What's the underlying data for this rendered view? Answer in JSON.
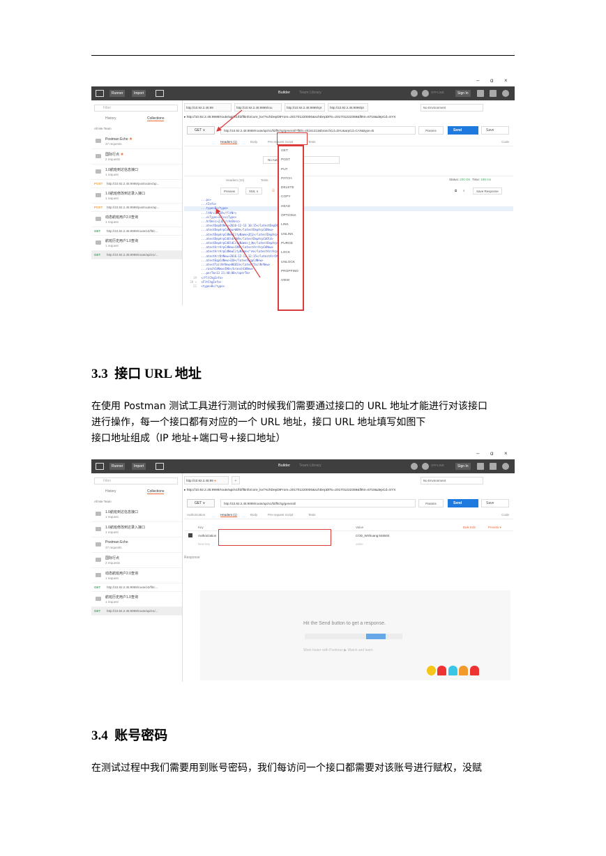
{
  "sections": {
    "s33": {
      "number": "3.3",
      "title": "接口 URL 地址"
    },
    "s34": {
      "number": "3.4",
      "title": "账号密码"
    }
  },
  "paragraphs": {
    "p1_line1": "在使用 Postman 测试工具进行测试的时候我们需要通过接口的 URL 地址才能进行对该接口",
    "p1_line2": "进行操作，每一个接口都有对应的一个 URL 地址，接口 URL 地址填写如图下",
    "p1_line3": "接口地址组成（IP 地址+端口号+接口地址）",
    "p2_line1": "在测试过程中我们需要用到账号密码，我们每访问一个接口都需要对该账号进行赋权，没赋"
  },
  "postman": {
    "window_controls": [
      "–",
      "ɑ",
      "×"
    ],
    "toolbar": {
      "runner": "Runner",
      "import": "Import",
      "builder": "Builder",
      "team_library": "Team Library",
      "offline": "OFFLINE",
      "sign_in": "Sign In"
    },
    "sidebar": {
      "filter_placeholder": "Filter",
      "history_tab": "History",
      "collections_tab": "Collections",
      "sort_row": "All   Me   Team",
      "requests_label": "1 request"
    },
    "shot1": {
      "tabs": [
        "http://10.92.2.45:99",
        "http://10.92.2.45:9999/rou",
        "http://10.92.2.45:9999/rpt",
        "http://10.92.2.45:9999/pt"
      ],
      "environment": "No Environment",
      "url_line": "▸ http://10.92.2.45:9999/route/api/v1/fd/fltinfo/core_kv/?schDepDtFrom=201701220000&schDepDtTo=201701222359&fltNr=6718&depCd=SYX",
      "method": "GET",
      "url_value": "http://10.92.2.45:9999/route/api/v1/fd/fltchg/general/?fltDt=20161213&branchCd=ZHU&arpCd=CAN&type=B",
      "params": "Params",
      "send": "Send",
      "save": "Save",
      "opts": {
        "headers": "Headers (1)",
        "body": "Body",
        "prereq": "Pre-request Script",
        "tests": "Tests",
        "code": "Code"
      },
      "no_auth": "No Auth",
      "res_tabs": {
        "headers": "Headers (10)",
        "tests": "Tests"
      },
      "status_label": "Status:",
      "status_value": "200 OK",
      "time_label": "Time:",
      "time_value": "199 ms",
      "preview": "Preview",
      "xml": "XML",
      "save_response": "Save Response",
      "methods": [
        "GET",
        "POST",
        "PUT",
        "PATCH",
        "DELETE",
        "COPY",
        "HEAD",
        "OPTIONS",
        "LINK",
        "UNLINK",
        "PURGE",
        "LOCK",
        "UNLOCK",
        "PROPFIND",
        "VIEW"
      ],
      "sidebar_items": [
        {
          "kind": "folder",
          "title": "Postman Echo",
          "star": true,
          "sub": "37 requests"
        },
        {
          "kind": "folder",
          "title": "国际行点",
          "star": true,
          "sub": "2 requests"
        },
        {
          "kind": "folder",
          "title": "1.0航班到达信息接口",
          "sub": "1 request"
        },
        {
          "kind": "req",
          "method": "POST",
          "url": "http://10.92.2.45:9999/postrouter/ap..."
        },
        {
          "kind": "folder",
          "title": "1.0航班修改到达录入接口",
          "sub": "1 request"
        },
        {
          "kind": "req",
          "method": "POST",
          "url": "http://10.92.2.45:9999/postrouter/ap..."
        },
        {
          "kind": "folder",
          "title": "动态航班用户2.0查询",
          "sub": "1 request"
        },
        {
          "kind": "req",
          "method": "GET",
          "url": "http://10.92.2.45:9999/route/v2/flt/c..."
        },
        {
          "kind": "folder",
          "title": "航班历史用户1.0查询",
          "sub": "1 request"
        },
        {
          "kind": "req",
          "method": "GET",
          "url": "http://10.92.2.45:9999/route/api/v1/...",
          "selected": true
        }
      ],
      "xml_lines": [
        {
          "n": "",
          "t": "    ...ps>"
        },
        {
          "n": "",
          "t": "    ...tInfo>"
        },
        {
          "n": "",
          "t": "    ...type>B</type>",
          "hl": true
        },
        {
          "n": "",
          "t": "    ...ltNr>3081A</fltNr>"
        },
        {
          "n": "",
          "t": "    ...vcType>3</svcType>"
        },
        {
          "n": "",
          "t": "    ...hrDesc>正班</chnDesc>"
        },
        {
          "n": "",
          "t": "    ...atestDepDtNew>2016-12-13 10:15</latestDepDtNew>"
        },
        {
          "n": "",
          "t": "    ...atestDepArpCdNew>WUH</latestDepArpCdNew>"
        },
        {
          "n": "",
          "t": "    ...atestDepArpCdNewCityName>武汉</latestDepArpCdNewCityName>"
        },
        {
          "n": "",
          "t": "    ...atestDepArpCdOld>SHA</latestDepArpCdOld>"
        },
        {
          "n": "",
          "t": "    ...atestDepArpCdOldCityName>上海</latestDepArpCdOldCityName>"
        },
        {
          "n": "",
          "t": "    ...atestArrArpCdNew>CAN</latestArrArpCdNew>"
        },
        {
          "n": "",
          "t": "    ...atestArrArpCdNewCityName>广州</latestArrArpCdNewCityName>"
        },
        {
          "n": "",
          "t": "    ...atestArrDtNew>2016-12-13 12:15</latestArrDtNew>"
        },
        {
          "n": "",
          "t": "    ...atestEqpCdNew>320</latestEqpCdNew>"
        },
        {
          "n": "",
          "t": "    ...atestTailNrNew>B6653</latestTailNrNew>"
        },
        {
          "n": "",
          "t": "    ...ranchCdNew>ZHU</branchCdNew>"
        },
        {
          "n": "",
          "t": "    ...perTm>13 21:40:00</operTm>"
        },
        {
          "n": "19",
          "t": "  </FltChgInfo>"
        },
        {
          "n": "20 ▾",
          "t": "  <FltChgInfo>"
        },
        {
          "n": "21",
          "t": "    <type>B</type>"
        }
      ]
    },
    "shot2": {
      "tab": "http://10.92.2.45:99",
      "tab_add": "+",
      "environment": "No Environment",
      "url_line": "▸ http://10.92.2.45:9999/route/api/v1/fd/fltinfo/core_kv/?schDepDtFrom=201701220000&schDepDtTo=201701222359&fltNr=6718&depCd=SYX",
      "method": "GET",
      "url_value": "http://10.92.2.45:9999/route/api/v1/fd/fltchg/general/",
      "params": "Params",
      "send": "Send",
      "save": "Save",
      "opts": {
        "authorization": "Authorization",
        "headers": "Headers (1)",
        "body": "Body",
        "prereq": "Pre-request Script",
        "tests": "Tests",
        "code": "Code"
      },
      "kv": {
        "key": "Key",
        "value": "Value",
        "bulk_edit": "Bulk Edit",
        "presets": "Presets ▾"
      },
      "kv_row": {
        "key": "Authorization",
        "value": "COD_WShuang:646504"
      },
      "kv_new": {
        "key": "New key",
        "value": "value"
      },
      "response": "Response",
      "hint": "Hit the Send button to get a response.",
      "hint2": "Work faster with Postman  ▶  Watch and learn",
      "sidebar_items": [
        {
          "kind": "folder",
          "title": "1.0航班到达信息接口",
          "sub": "1 request"
        },
        {
          "kind": "folder",
          "title": "1.0航班修改到达录入接口",
          "sub": "1 request"
        },
        {
          "kind": "folder",
          "title": "Postman Echo",
          "sub": "37 requests"
        },
        {
          "kind": "folder",
          "title": "国际行点",
          "sub": "2 requests"
        },
        {
          "kind": "folder",
          "title": "动态航班用户2.0查询",
          "sub": "1 request"
        },
        {
          "kind": "req",
          "method": "GET",
          "url": "http://10.92.2.45:9999/route/v2/flt/c..."
        },
        {
          "kind": "folder",
          "title": "航班历史用户1.0查询",
          "sub": "1 request"
        },
        {
          "kind": "req",
          "method": "GET",
          "url": "http://10.92.2.45:9999/route/api/v1/...",
          "selected": true
        }
      ]
    }
  },
  "colors": {
    "accent": "#f26b3a",
    "send": "#1f7ae0",
    "annotation": "#d93a3a",
    "appbar": "#3f3f3f"
  }
}
